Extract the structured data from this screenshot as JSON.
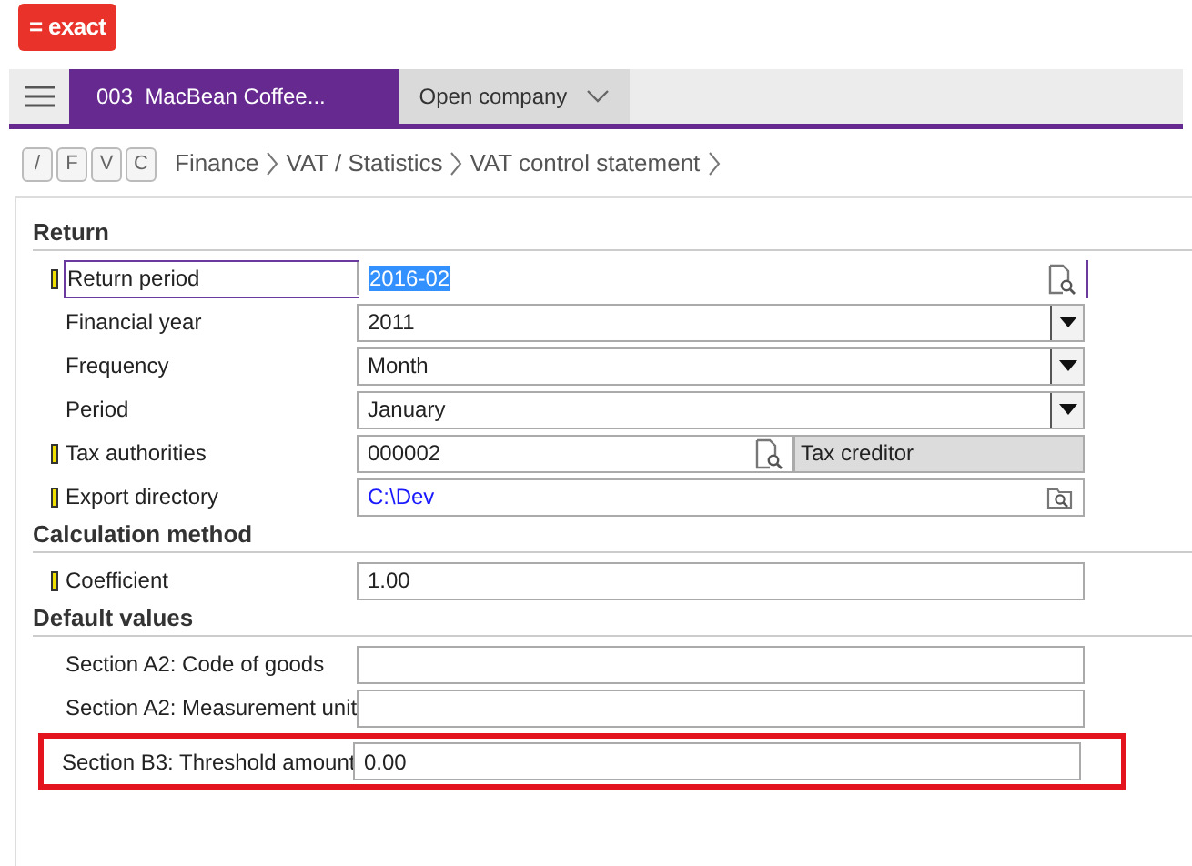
{
  "logo": "= exact",
  "topbar": {
    "company": "003  MacBean Coffee...",
    "open_company": "Open company"
  },
  "shortcuts": [
    {
      "label": "/"
    },
    {
      "label": "F"
    },
    {
      "label": "V"
    },
    {
      "label": "C"
    }
  ],
  "breadcrumb": [
    "Finance",
    "VAT / Statistics",
    "VAT control statement"
  ],
  "sections": [
    {
      "title": "Return",
      "fields": [
        {
          "label": "Return period",
          "value": "2016-02",
          "kind": "lookup",
          "required": true,
          "focused": true
        },
        {
          "label": "Financial year",
          "value": "2011",
          "kind": "select"
        },
        {
          "label": "Frequency",
          "value": "Month",
          "kind": "select"
        },
        {
          "label": "Period",
          "value": "January",
          "kind": "select"
        },
        {
          "label": "Tax authorities",
          "value": "000002",
          "description": "Tax creditor",
          "kind": "lookup-described",
          "required": true
        },
        {
          "label": "Export directory",
          "value": "C:\\Dev",
          "kind": "folder",
          "required": true,
          "link": true
        }
      ]
    },
    {
      "title": "Calculation method",
      "fields": [
        {
          "label": "Coefficient",
          "value": "1.00",
          "kind": "text",
          "required": true
        }
      ]
    },
    {
      "title": "Default values",
      "fields": [
        {
          "label": "Section A2: Code of goods",
          "kind": "text"
        },
        {
          "label": "Section A2: Measurement unit",
          "kind": "text"
        },
        {
          "label": "Section B3: Threshold amount",
          "value": "0.00",
          "kind": "text",
          "highlighted": true
        }
      ]
    }
  ]
}
